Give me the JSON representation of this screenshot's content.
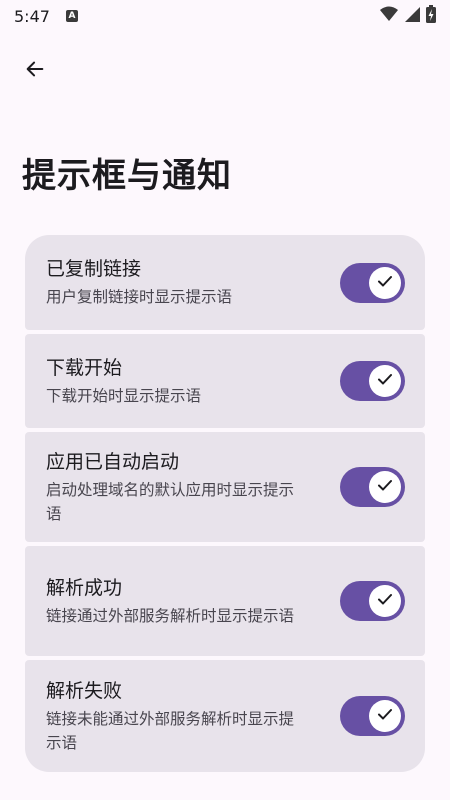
{
  "status": {
    "time": "5:47",
    "notification_badge": "A"
  },
  "header": {
    "back_icon": "arrow-left-icon"
  },
  "page": {
    "title": "提示框与通知"
  },
  "colors": {
    "accent": "#6750A4",
    "card": "#E8E3EB",
    "background": "#FDF8FD"
  },
  "settings": [
    {
      "title": "已复制链接",
      "description": "用户复制链接时显示提示语",
      "enabled": true
    },
    {
      "title": "下载开始",
      "description": "下载开始时显示提示语",
      "enabled": true
    },
    {
      "title": "应用已自动启动",
      "description": "启动处理域名的默认应用时显示提示语",
      "enabled": true
    },
    {
      "title": "解析成功",
      "description": "链接通过外部服务解析时显示提示语",
      "enabled": true
    },
    {
      "title": "解析失败",
      "description": "链接未能通过外部服务解析时显示提示语",
      "enabled": true
    }
  ]
}
